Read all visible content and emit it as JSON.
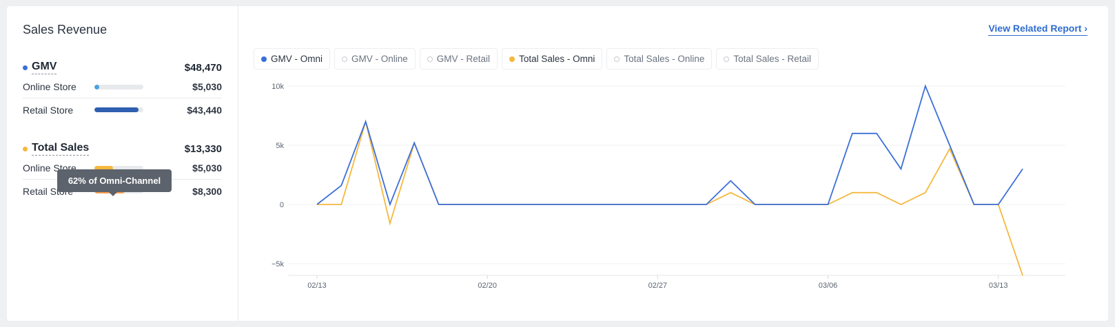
{
  "panel": {
    "title": "Sales Revenue",
    "gmv": {
      "name": "GMV",
      "total": "$48,470",
      "dot_color": "#3b6fd8",
      "rows": [
        {
          "label": "Online Store",
          "value": "$5,030",
          "fraction": 0.1,
          "color": "#4aa3df"
        },
        {
          "label": "Retail Store",
          "value": "$43,440",
          "fraction": 0.9,
          "color": "#2f5fb0"
        }
      ]
    },
    "total_sales": {
      "name": "Total Sales",
      "total": "$13,330",
      "dot_color": "#f5b83d",
      "rows": [
        {
          "label": "Online Store",
          "value": "$5,030",
          "fraction": 0.38,
          "color": "#f5b83d"
        },
        {
          "label": "Retail Store",
          "value": "$8,300",
          "fraction": 0.62,
          "color": "#f59b4c"
        }
      ]
    },
    "tooltip": "62% of Omni-Channel"
  },
  "report_link": "View Related Report ›",
  "legend": [
    {
      "label": "GMV - Omni",
      "active": true,
      "color": "#3b6fd8"
    },
    {
      "label": "GMV - Online",
      "active": false,
      "color": "#c7cbd1"
    },
    {
      "label": "GMV - Retail",
      "active": false,
      "color": "#c7cbd1"
    },
    {
      "label": "Total Sales - Omni",
      "active": true,
      "color": "#f5b83d"
    },
    {
      "label": "Total Sales - Online",
      "active": false,
      "color": "#c7cbd1"
    },
    {
      "label": "Total Sales - Retail",
      "active": false,
      "color": "#c7cbd1"
    }
  ],
  "chart_data": {
    "type": "line",
    "x_tick_labels": [
      "02/13",
      "02/20",
      "02/27",
      "03/06",
      "03/13"
    ],
    "y_tick_labels": [
      "10k",
      "5k",
      "0",
      "−5k"
    ],
    "y_ticks": [
      10000,
      5000,
      0,
      -5000
    ],
    "ylim": [
      -6000,
      10000
    ],
    "grid": true,
    "x": [
      "02/13",
      "02/14",
      "02/15",
      "02/16",
      "02/17",
      "02/18",
      "02/19",
      "02/20",
      "02/21",
      "02/22",
      "02/23",
      "02/24",
      "02/25",
      "02/26",
      "02/27",
      "02/28",
      "03/01",
      "03/02",
      "03/03",
      "03/04",
      "03/05",
      "03/06",
      "03/07",
      "03/08",
      "03/09",
      "03/10",
      "03/11",
      "03/12",
      "03/13",
      "03/14"
    ],
    "series": [
      {
        "name": "GMV - Omni",
        "color": "#3b6fd8",
        "values": [
          0,
          1600,
          7000,
          0,
          5200,
          0,
          0,
          0,
          0,
          0,
          0,
          0,
          0,
          0,
          0,
          0,
          0,
          2000,
          0,
          0,
          0,
          0,
          6000,
          6000,
          3000,
          10000,
          5000,
          0,
          0,
          3000
        ]
      },
      {
        "name": "Total Sales - Omni",
        "color": "#f5b83d",
        "values": [
          0,
          0,
          7000,
          -1600,
          5200,
          0,
          0,
          0,
          0,
          0,
          0,
          0,
          0,
          0,
          0,
          0,
          0,
          1000,
          0,
          0,
          0,
          0,
          1000,
          1000,
          0,
          1000,
          4700,
          0,
          0,
          -6000
        ]
      }
    ]
  }
}
